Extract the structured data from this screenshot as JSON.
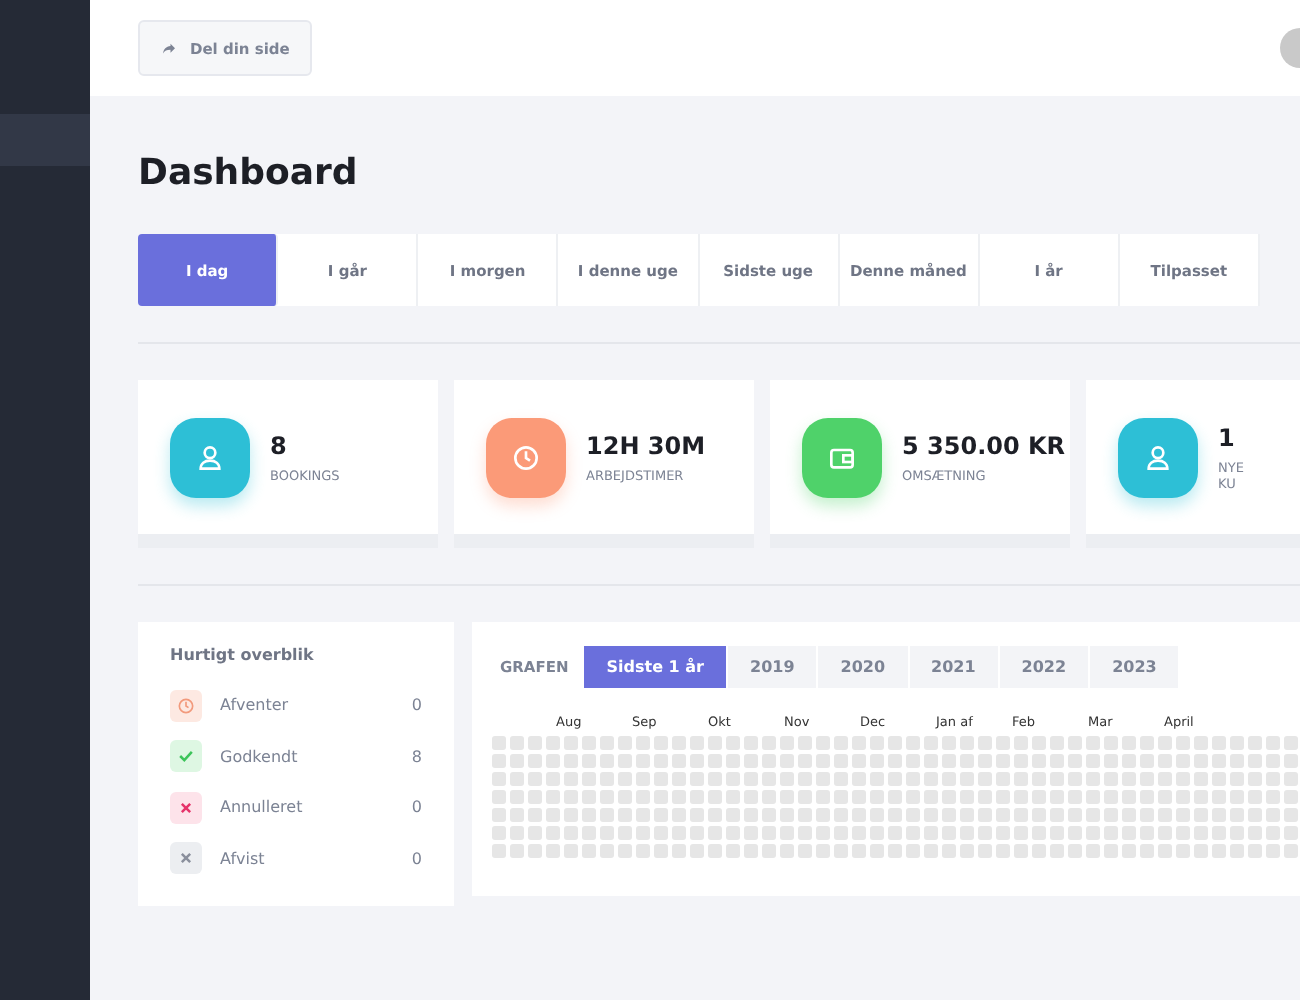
{
  "header": {
    "share_button": "Del din side"
  },
  "page_title": "Dashboard",
  "period_tabs": [
    {
      "label": "I dag",
      "selected": true
    },
    {
      "label": "I går",
      "selected": false
    },
    {
      "label": "I morgen",
      "selected": false
    },
    {
      "label": "I denne uge",
      "selected": false
    },
    {
      "label": "Sidste uge",
      "selected": false
    },
    {
      "label": "Denne måned",
      "selected": false
    },
    {
      "label": "I år",
      "selected": false
    },
    {
      "label": "Tilpasset",
      "selected": false
    }
  ],
  "stats": [
    {
      "kind": "user",
      "color": "#2dbfd6",
      "value": "8",
      "label": "BOOKINGS"
    },
    {
      "kind": "clock",
      "color": "#fb9a78",
      "value": "12H 30M",
      "label": "ARBEJDSTIMER"
    },
    {
      "kind": "wallet",
      "color": "#4fd26a",
      "value": "5 350.00 KR",
      "label": "OMSÆTNING"
    },
    {
      "kind": "user",
      "color": "#2dbfd6",
      "value": "1",
      "label": "NYE KU"
    }
  ],
  "overview": {
    "title": "Hurtigt overblik",
    "items": [
      {
        "kind": "pending",
        "label": "Afventer",
        "count": "0"
      },
      {
        "kind": "approved",
        "label": "Godkendt",
        "count": "8"
      },
      {
        "kind": "cancelled",
        "label": "Annulleret",
        "count": "0"
      },
      {
        "kind": "rejected",
        "label": "Afvist",
        "count": "0"
      }
    ]
  },
  "graph": {
    "label": "GRAFEN",
    "tabs": [
      {
        "label": "Sidste 1 år",
        "selected": true
      },
      {
        "label": "2019",
        "selected": false
      },
      {
        "label": "2020",
        "selected": false
      },
      {
        "label": "2021",
        "selected": false
      },
      {
        "label": "2022",
        "selected": false
      },
      {
        "label": "2023",
        "selected": false
      }
    ],
    "months": [
      "Aug",
      "Sep",
      "Okt",
      "Nov",
      "Dec",
      "Jan af",
      "Feb",
      "Mar",
      "April"
    ]
  }
}
